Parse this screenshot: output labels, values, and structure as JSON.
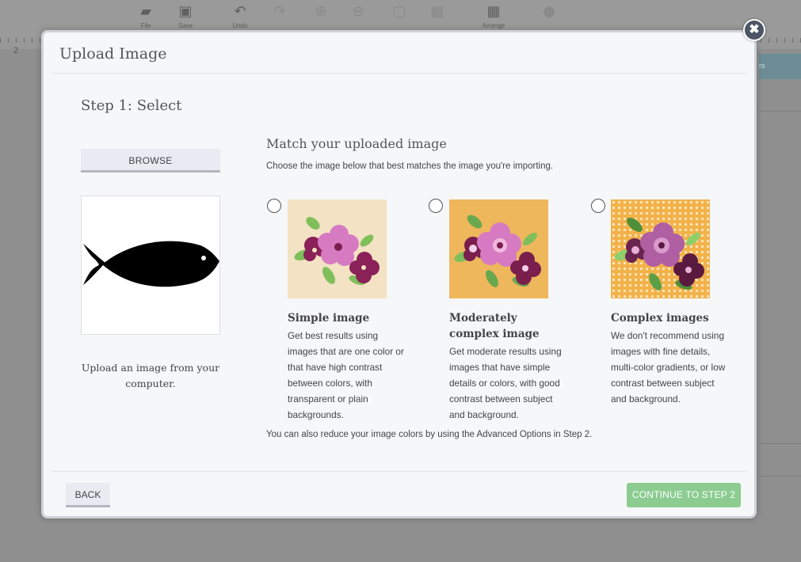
{
  "background_app": {
    "toolbar": [
      {
        "label": "File",
        "icon": "folder-icon",
        "glyph": "🗀"
      },
      {
        "label": "Save",
        "icon": "save-icon",
        "glyph": "💾"
      },
      {
        "label": "Undo",
        "icon": "undo-icon",
        "glyph": "↶"
      },
      {
        "label": "Redo",
        "icon": "redo-icon",
        "glyph": "↷"
      },
      {
        "label": "Arrange",
        "icon": "arrange-icon",
        "glyph": "▦"
      }
    ],
    "ruler_number": "2",
    "right_panel_label": "rs"
  },
  "modal": {
    "title": "Upload Image",
    "close_symbol": "✖",
    "step_title": "Step 1: Select",
    "browse_label": "BROWSE",
    "upload_hint": "Upload an image from your computer.",
    "match_title": "Match your uploaded image",
    "match_subtitle": "Choose the image below that best matches the image you're importing.",
    "options": [
      {
        "title": "Simple image",
        "description": "Get best results using images that are one color or that have high contrast between colors, with transparent or plain backgrounds.",
        "thumb_bg": "#f3e2c3",
        "icon": "simple-flower-thumbnail"
      },
      {
        "title": "Moderately complex image",
        "description": "Get moderate results using images that have simple details or colors, with good contrast between subject and background.",
        "thumb_bg": "#eeb75c",
        "icon": "moderate-flower-thumbnail"
      },
      {
        "title": "Complex images",
        "description": "We don't recommend using images with fine details, multi-color gradients, or low contrast between subject and background.",
        "thumb_bg": "#f2b24a",
        "icon": "complex-flower-thumbnail"
      }
    ],
    "footnote": "You can also reduce your image colors by using the Advanced Options in Step 2.",
    "back_label": "BACK",
    "continue_label": "CONTINUE TO STEP 2"
  },
  "colors": {
    "continue_button": "#8ccc91",
    "close_button": "#4c5566",
    "flower_pink": "#d67bc2",
    "flower_purple": "#7a1e4d",
    "leaf_green": "#7fbf5a"
  }
}
